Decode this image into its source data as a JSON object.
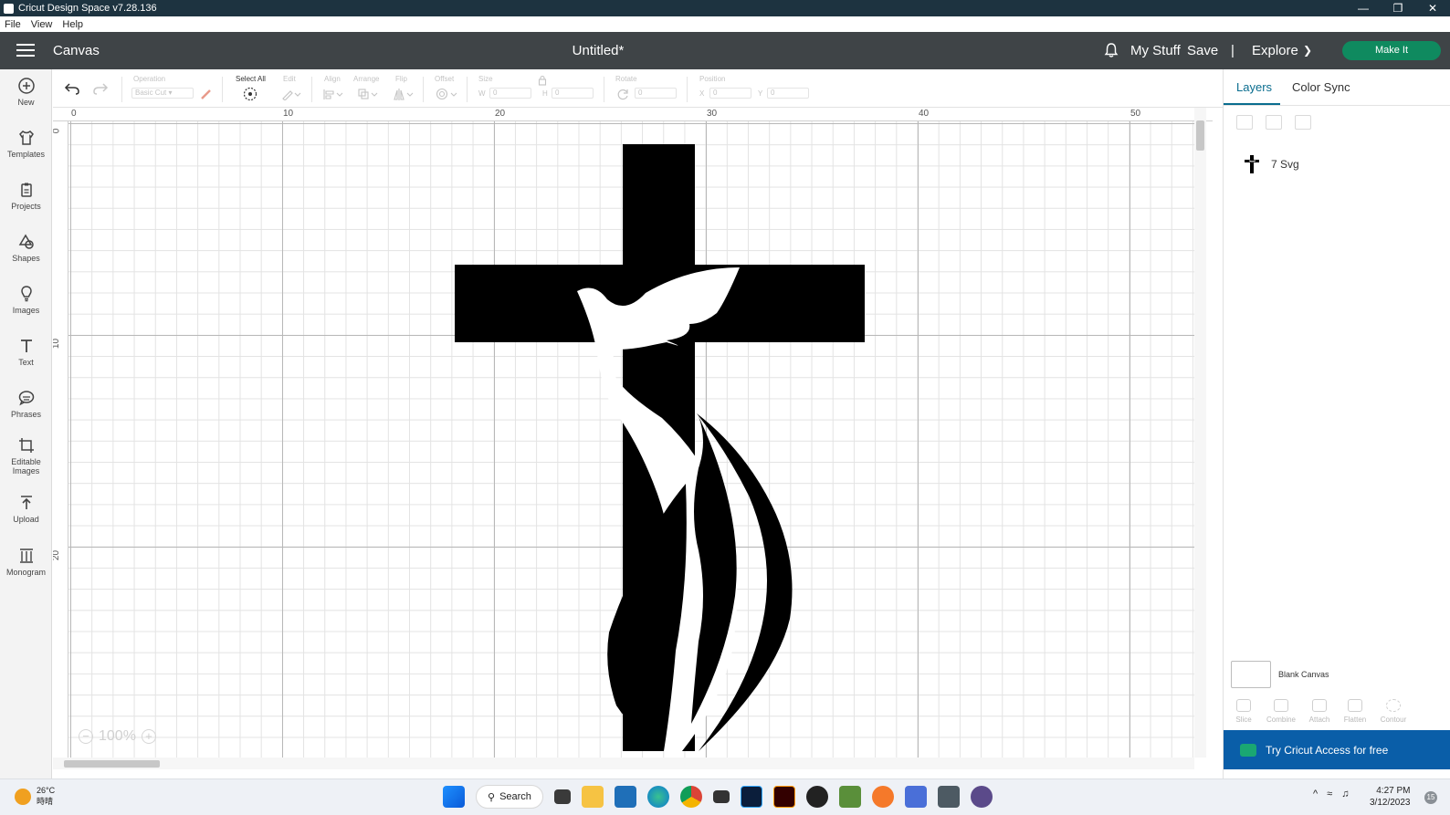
{
  "window": {
    "title": "Cricut Design Space  v7.28.136",
    "minimize": "—",
    "restore": "❐",
    "close": "✕"
  },
  "menu": [
    "File",
    "View",
    "Help"
  ],
  "header": {
    "section": "Canvas",
    "doc_title": "Untitled*",
    "mystuff": "My Stuff",
    "save": "Save",
    "separator": "|",
    "explore": "Explore",
    "make_it": "Make It"
  },
  "sidebar": [
    {
      "label": "New",
      "icon": "plus-circle-icon"
    },
    {
      "label": "Templates",
      "icon": "shirt-icon"
    },
    {
      "label": "Projects",
      "icon": "clipboard-icon"
    },
    {
      "label": "Shapes",
      "icon": "shapes-icon"
    },
    {
      "label": "Images",
      "icon": "lightbulb-icon"
    },
    {
      "label": "Text",
      "icon": "text-icon"
    },
    {
      "label": "Phrases",
      "icon": "speech-bubble-icon"
    },
    {
      "label": "Editable Images",
      "icon": "crop-icon"
    },
    {
      "label": "Upload",
      "icon": "upload-icon"
    },
    {
      "label": "Monogram",
      "icon": "monogram-icon"
    }
  ],
  "toolbar": {
    "operation_label": "Operation",
    "operation_value": "Basic Cut",
    "select_all": "Select All",
    "edit": "Edit",
    "align": "Align",
    "arrange": "Arrange",
    "flip": "Flip",
    "offset": "Offset",
    "size": "Size",
    "w": "W",
    "h": "H",
    "w_value": "0",
    "h_value": "0",
    "rotate": "Rotate",
    "rotate_value": "0",
    "position": "Position",
    "x": "X",
    "y": "Y",
    "x_value": "0",
    "y_value": "0"
  },
  "rulers": {
    "top": [
      "0",
      "10",
      "20",
      "30",
      "40",
      "50"
    ],
    "left": [
      "0",
      "10",
      "20"
    ]
  },
  "zoom": {
    "value": "100%",
    "minus": "−",
    "plus": "+"
  },
  "panel": {
    "tabs": [
      "Layers",
      "Color Sync"
    ],
    "layer_name": "7 Svg",
    "blank_canvas": "Blank Canvas",
    "tools": [
      "Slice",
      "Combine",
      "Attach",
      "Flatten",
      "Contour"
    ],
    "try_access": "Try Cricut Access for free"
  },
  "taskbar": {
    "temperature": "26°C",
    "weather_text": "時晴",
    "search": "Search",
    "time": "4:27 PM",
    "date": "3/12/2023",
    "notifications": "15",
    "tray_arrow": "^"
  },
  "colors": {
    "header": "#3f4447",
    "make_it": "#0f8a5f",
    "accent": "#0a6d8f",
    "try_access": "#0a5ea8",
    "titlebar": "#1d3340"
  }
}
